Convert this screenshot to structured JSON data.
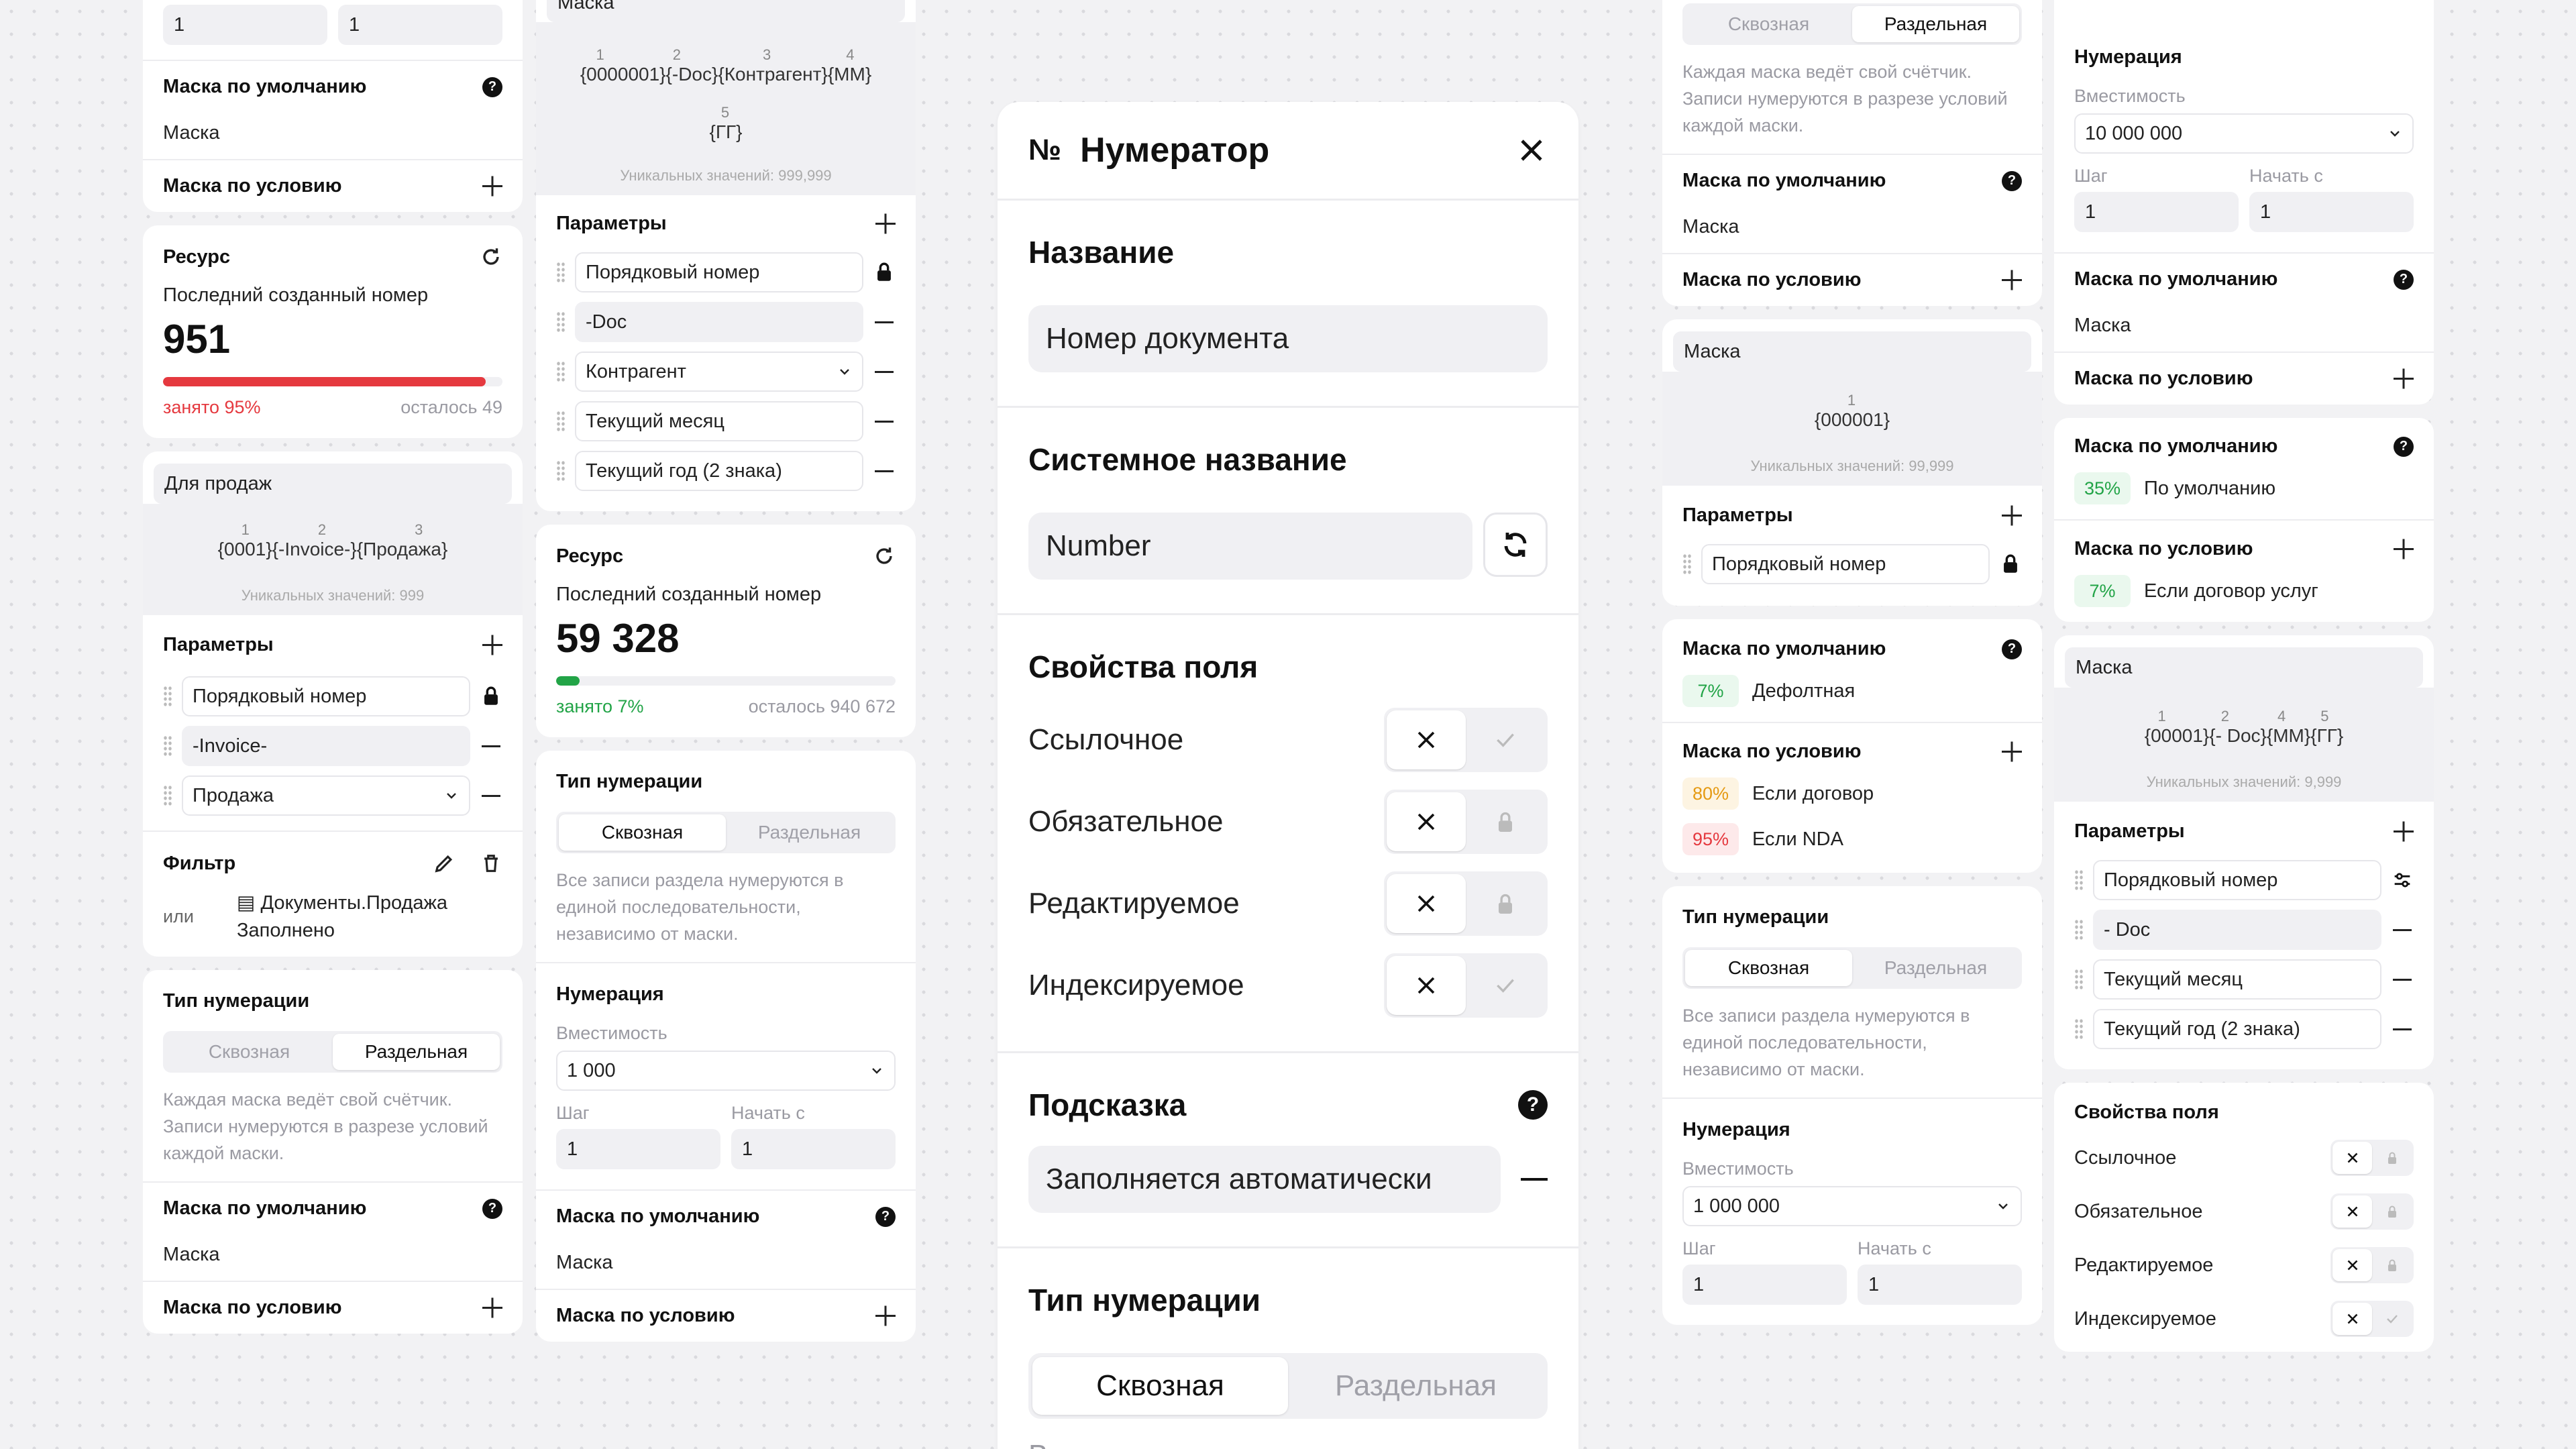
{
  "c1": {
    "top_inputs": [
      "1",
      "1"
    ],
    "default_mask": {
      "title": "Маска по умолчанию",
      "value": "Маска"
    },
    "cond_mask": {
      "title": "Маска по условию"
    },
    "resource": {
      "title": "Ресурс",
      "label": "Последний созданный номер",
      "number": "951",
      "used": "занято 95%",
      "left": "осталось 49",
      "fill": 0.95
    },
    "sales": {
      "name": "Для продаж",
      "nums": [
        "1",
        "2",
        "3"
      ],
      "pattern": "{0001}{-Invoice-}{Продажа}",
      "unique": "Уникальных значений: 999",
      "params_title": "Параметры",
      "params": [
        "Порядковый номер",
        "-Invoice-",
        "Продажа"
      ],
      "filter_title": "Фильтр",
      "filter_or": "или",
      "filter_doc": "Документы.Продажа",
      "filter_state": "Заполнено"
    },
    "numtype": {
      "title": "Тип нумерации",
      "seg_a": "Сквозная",
      "seg_b": "Раздельная",
      "desc": "Каждая маска ведёт свой счётчик. Записи нумеруются в разрезе условий каждой маски."
    },
    "default_mask2": {
      "title": "Маска по умолчанию",
      "value": "Маска"
    },
    "cond_mask2": {
      "title": "Маска по условию"
    }
  },
  "c2": {
    "mask_name": "Маска",
    "nums": [
      "1",
      "2",
      "3",
      "4"
    ],
    "pattern": "{0000001}{-Doc}{Контрагент}{ММ}",
    "nums2": [
      "5"
    ],
    "pattern2": "{ГГ}",
    "unique": "Уникальных значений: 999,999",
    "params_title": "Параметры",
    "params": [
      "Порядковый номер",
      "-Doc",
      "Контрагент",
      "Текущий месяц",
      "Текущий год (2 знака)"
    ],
    "resource": {
      "title": "Ресурс",
      "label": "Последний созданный номер",
      "number": "59 328",
      "used": "занято 7%",
      "left": "осталось 940 672",
      "fill": 0.07
    },
    "numtype": {
      "title": "Тип нумерации",
      "seg_a": "Сквозная",
      "seg_b": "Раздельная",
      "desc": "Все записи раздела нумеруются в единой последовательности, независимо от маски."
    },
    "numeration": {
      "title": "Нумерация",
      "capacity_label": "Вместимость",
      "capacity": "1 000",
      "step_label": "Шаг",
      "start_label": "Начать с",
      "step": "1",
      "start": "1"
    },
    "default_mask": {
      "title": "Маска по умолчанию",
      "value": "Маска"
    },
    "cond_mask": {
      "title": "Маска по условию"
    }
  },
  "modal": {
    "symbol": "№",
    "title": "Нумератор",
    "name_title": "Название",
    "name_value": "Номер документа",
    "sys_title": "Системное название",
    "sys_value": "Number",
    "props_title": "Свойства поля",
    "props": [
      "Ссылочное",
      "Обязательное",
      "Редактируемое",
      "Индексируемое"
    ],
    "hint_title": "Подсказка",
    "hint_value": "Заполняется автоматически",
    "numtype_title": "Тип нумерации",
    "seg_a": "Сквозная",
    "seg_b": "Раздельная",
    "desc_partial": "Все записи раздела нумеруются в"
  },
  "c4": {
    "seg_a": "Сквозная",
    "seg_b": "Раздельная",
    "desc": "Каждая маска ведёт свой счётчик. Записи нумеруются в разрезе условий каждой маски.",
    "default_mask": {
      "title": "Маска по умолчанию",
      "value": "Маска"
    },
    "cond_mask": {
      "title": "Маска по условию"
    },
    "mask": {
      "name": "Маска",
      "nums": [
        "1"
      ],
      "pattern": "{000001}",
      "unique": "Уникальных значений: 99,999",
      "params_title": "Параметры",
      "param": "Порядковый номер"
    },
    "default_mask2": {
      "title": "Маска по умолчанию",
      "pct": "7%",
      "value": "Дефолтная"
    },
    "cond_mask2": {
      "title": "Маска по условию",
      "items": [
        {
          "pct": "80%",
          "label": "Если договор"
        },
        {
          "pct": "95%",
          "label": "Если NDA"
        }
      ]
    },
    "numtype": {
      "title": "Тип нумерации",
      "seg_a": "Сквозная",
      "seg_b": "Раздельная",
      "desc": "Все записи раздела нумеруются в единой последовательности, независимо от маски."
    },
    "numeration": {
      "title": "Нумерация",
      "capacity_label": "Вместимость",
      "capacity": "1 000 000",
      "step_label": "Шаг",
      "start_label": "Начать с",
      "step": "1",
      "start": "1"
    }
  },
  "c5": {
    "numeration": {
      "title": "Нумерация",
      "capacity_label": "Вместимость",
      "capacity": "10 000 000",
      "step_label": "Шаг",
      "start_label": "Начать с",
      "step": "1",
      "start": "1"
    },
    "default_mask": {
      "title": "Маска по умолчанию",
      "value": "Маска"
    },
    "cond_mask": {
      "title": "Маска по условию"
    },
    "default_mask2": {
      "title": "Маска по умолчанию",
      "pct": "35%",
      "value": "По умолчанию"
    },
    "cond_mask2": {
      "title": "Маска по условию",
      "pct": "7%",
      "value": "Если договор услуг"
    },
    "mask": {
      "name": "Маска",
      "nums": [
        "1",
        "2",
        "4",
        "5"
      ],
      "pattern": "{00001}{- Doc}{ММ}{ГГ}",
      "unique": "Уникальных значений: 9,999",
      "params_title": "Параметры",
      "params": [
        "Порядковый номер",
        "- Doc",
        "Текущий месяц",
        "Текущий год (2 знака)"
      ]
    },
    "props": {
      "title": "Свойства поля",
      "items": [
        "Ссылочное",
        "Обязательное",
        "Редактируемое",
        "Индексируемое"
      ]
    }
  },
  "colors": {
    "accent_red": "#e5393f",
    "accent_green": "#22a447",
    "accent_orange": "#e59a13"
  }
}
